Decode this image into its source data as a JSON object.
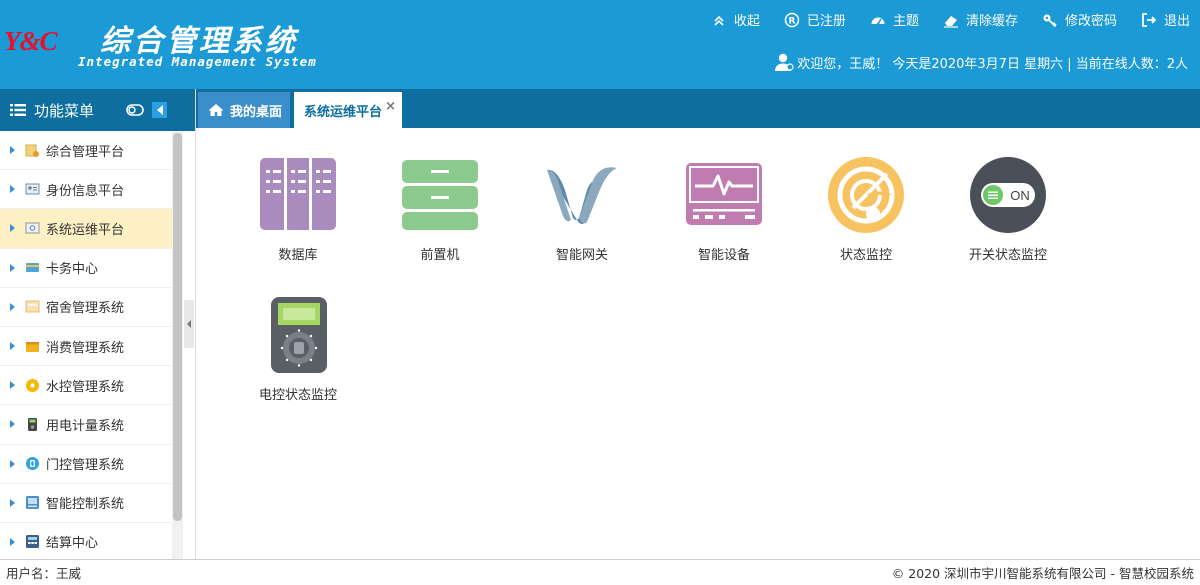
{
  "header": {
    "logo_mark": "Y&C",
    "title": "综合管理系统",
    "subtitle": "Integrated Management System",
    "nav": [
      {
        "label": "收起",
        "icon": "double-chevron-up-icon"
      },
      {
        "label": "已注册",
        "icon": "registered-icon"
      },
      {
        "label": "主题",
        "icon": "dashboard-icon"
      },
      {
        "label": "清除缓存",
        "icon": "eraser-icon"
      },
      {
        "label": "修改密码",
        "icon": "key-icon"
      },
      {
        "label": "退出",
        "icon": "logout-icon"
      }
    ],
    "welcome": "欢迎您，王威！ 今天是2020年3月7日 星期六 | 当前在线人数：2人"
  },
  "sidebar": {
    "title": "功能菜单",
    "items": [
      {
        "label": "综合管理平台",
        "icon": "folder-settings-icon"
      },
      {
        "label": "身份信息平台",
        "icon": "id-card-icon"
      },
      {
        "label": "系统运维平台",
        "icon": "maintenance-icon"
      },
      {
        "label": "卡务中心",
        "icon": "card-icon"
      },
      {
        "label": "宿舍管理系统",
        "icon": "dormitory-icon"
      },
      {
        "label": "消费管理系统",
        "icon": "wallet-icon"
      },
      {
        "label": "水控管理系统",
        "icon": "water-icon"
      },
      {
        "label": "用电计量系统",
        "icon": "electric-meter-icon"
      },
      {
        "label": "门控管理系统",
        "icon": "door-control-icon"
      },
      {
        "label": "智能控制系统",
        "icon": "smart-control-icon"
      },
      {
        "label": "结算中心",
        "icon": "settlement-icon"
      }
    ],
    "active_index": 2
  },
  "tabs": {
    "home": "我的桌面",
    "active": "系统运维平台",
    "close": "×"
  },
  "apps": [
    {
      "label": "数据库",
      "icon": "database-icon",
      "color": "#a98bbd"
    },
    {
      "label": "前置机",
      "icon": "server-icon",
      "color": "#8cc98c"
    },
    {
      "label": "智能网关",
      "icon": "gateway-icon",
      "color": "#6c8fa8"
    },
    {
      "label": "智能设备",
      "icon": "monitor-pulse-icon",
      "color": "#c07cb0"
    },
    {
      "label": "状态监控",
      "icon": "radar-icon",
      "color": "#f7c260"
    },
    {
      "label": "开关状态监控",
      "icon": "toggle-switch-icon",
      "color": "#4a4f5a",
      "toggle_text": "ON"
    },
    {
      "label": "电控状态监控",
      "icon": "multimeter-icon",
      "color": "#5a5f66"
    }
  ],
  "footer": {
    "user": "用户名：王威",
    "copyright": "© 2020 深圳市宇川智能系统有限公司 - 智慧校园系统"
  }
}
